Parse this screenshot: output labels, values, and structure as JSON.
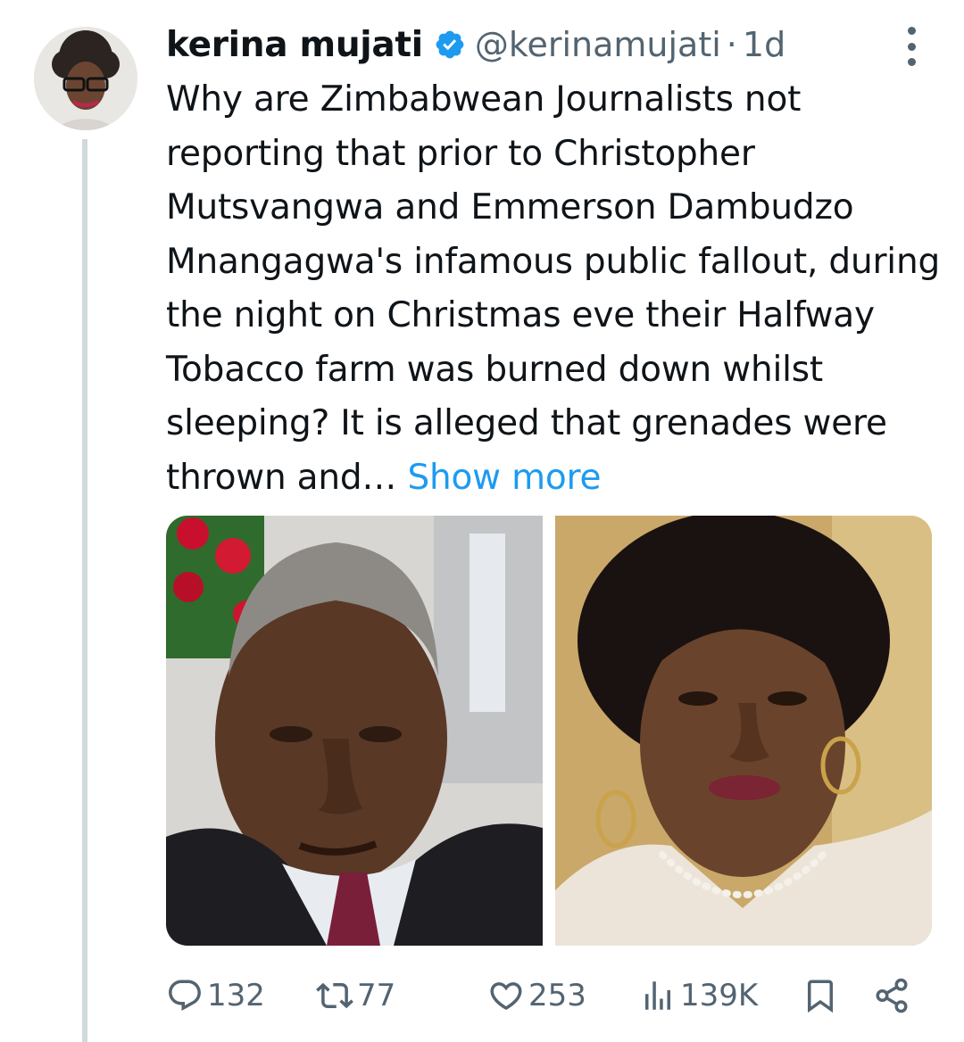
{
  "tweet": {
    "author_name": "kerina mujati",
    "handle": "@kerinamujati",
    "separator": "·",
    "time": "1d",
    "text": "Why are Zimbabwean Journalists not reporting that prior to Christopher Mutsvangwa and Emmerson Dambudzo Mnangagwa's infamous public fallout, during the night on Christmas eve their Halfway Tobacco farm was burned down whilst sleeping? It is alleged that grenades were thrown and…",
    "show_more": "Show more"
  },
  "actions": {
    "replies": "132",
    "reposts": "77",
    "likes": "253",
    "views": "139K"
  },
  "icons": {
    "verified": "verified-badge-icon",
    "more": "more-options-icon",
    "reply": "reply-icon",
    "repost": "repost-icon",
    "like": "heart-icon",
    "views": "views-icon",
    "bookmark": "bookmark-icon",
    "share": "share-icon"
  },
  "colors": {
    "accent": "#1d9bf0",
    "text": "#0f1419",
    "secondary": "#536471",
    "thread_line": "#cfd9de"
  }
}
